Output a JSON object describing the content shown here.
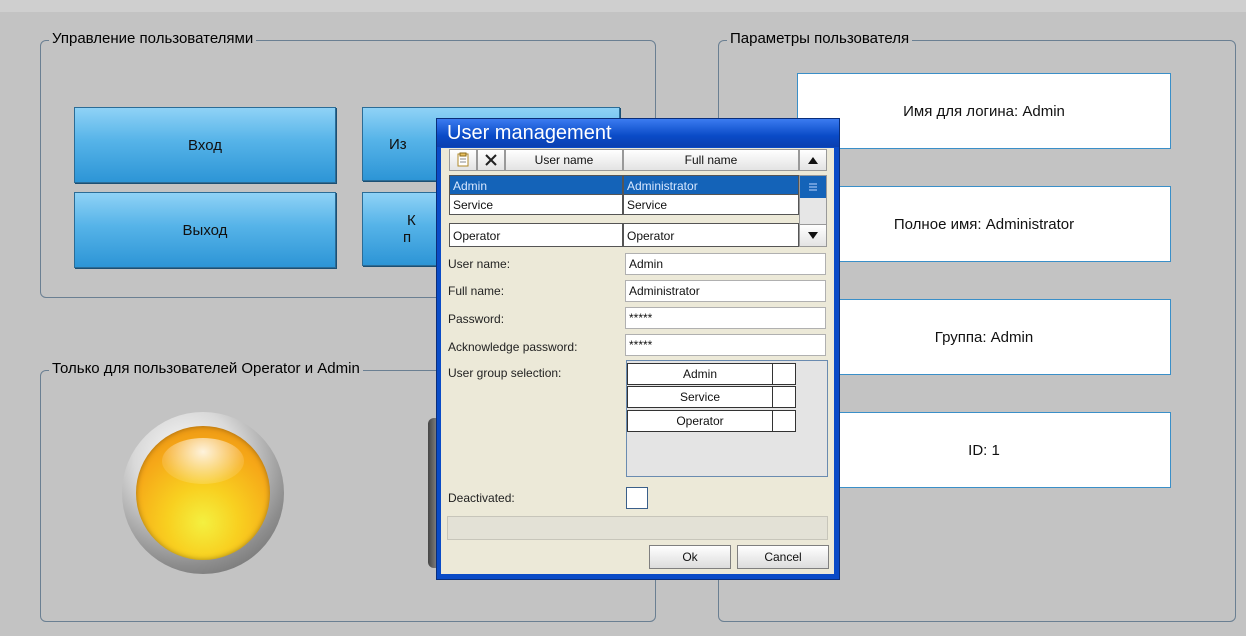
{
  "user_management": {
    "legend": "Управление  пользователями",
    "login_button": "Вход",
    "logout_button": "Выход",
    "change_button_partial": "Из",
    "third_button_partial_l1": "К",
    "third_button_partial_l2": "п"
  },
  "operator_admin_only": {
    "legend": "Только для пользователей Operator и Admin"
  },
  "user_parameters": {
    "legend": "Параметры пользователя",
    "login_name": "Имя для логина: Admin",
    "full_name": "Полное имя: Administrator",
    "group": "Группа: Admin",
    "id": "ID: 1"
  },
  "dialog": {
    "title": "User management",
    "table": {
      "col_user_name": "User name",
      "col_full_name": "Full name",
      "rows": [
        {
          "user_name": "Admin",
          "full_name": "Administrator",
          "selected": true
        },
        {
          "user_name": "Service",
          "full_name": "Service",
          "selected": false
        },
        {
          "user_name": "Operator",
          "full_name": "Operator",
          "selected": false
        }
      ]
    },
    "fields": {
      "user_name_label": "User name:",
      "user_name_value": "Admin",
      "full_name_label": "Full name:",
      "full_name_value": "Administrator",
      "password_label": "Password:",
      "password_value": "*****",
      "ack_password_label": "Acknowledge password:",
      "ack_password_value": "*****",
      "group_selection_label": "User group selection:",
      "groups": [
        "Admin",
        "Service",
        "Operator"
      ],
      "deactivated_label": "Deactivated:"
    },
    "ok_button": "Ok",
    "cancel_button": "Cancel"
  },
  "colors": {
    "background": "#c3c3c3",
    "button_blue": "#55b3e8",
    "dialog_title": "#0a4bc7",
    "selected_row": "#1463b8",
    "lamp": "#f6a818"
  }
}
